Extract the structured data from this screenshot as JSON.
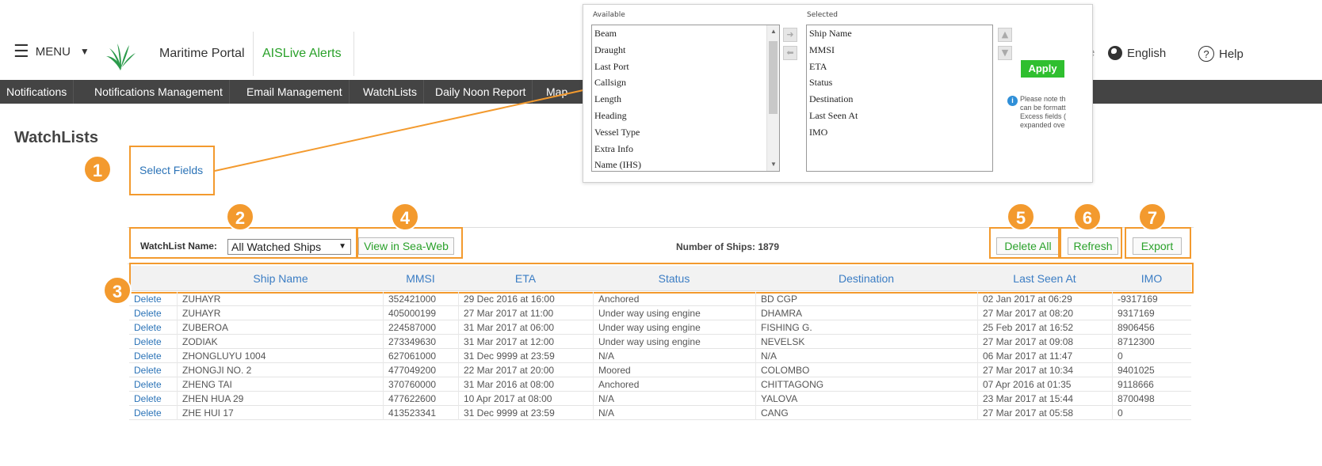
{
  "header": {
    "menu_label": "MENU",
    "portal_title": "Maritime Portal",
    "portal_sub": "AISLive Alerts",
    "faded_text": "e",
    "language": "English",
    "help": "Help",
    "help_symbol": "?"
  },
  "nav": {
    "items": [
      "Notifications",
      "Notifications Management",
      "Email Management",
      "WatchLists",
      "Daily Noon Report",
      "Map"
    ]
  },
  "page": {
    "title": "WatchLists",
    "select_fields": "Select Fields"
  },
  "popup": {
    "available_label": "Available",
    "selected_label": "Selected",
    "available": [
      "Beam",
      "Draught",
      "Last Port",
      "Callsign",
      "Length",
      "Heading",
      "Vessel Type",
      "Extra Info",
      "Name (IHS)"
    ],
    "selected": [
      "Ship Name",
      "MMSI",
      "ETA",
      "Status",
      "Destination",
      "Last Seen At",
      "IMO"
    ],
    "apply": "Apply",
    "note_lines": [
      "Please note th",
      "can be formatt",
      "Excess fields (",
      "expanded ove"
    ]
  },
  "toolbar": {
    "watchlist_label": "WatchList Name:",
    "watchlist_value": "All Watched Ships",
    "view_in_seaweb": "View in Sea-Web",
    "ships_count": "Number of Ships: 1879",
    "delete_all": "Delete All",
    "refresh": "Refresh",
    "export": "Export"
  },
  "table": {
    "columns": [
      "Ship Name",
      "MMSI",
      "ETA",
      "Status",
      "Destination",
      "Last Seen At",
      "IMO"
    ],
    "delete_label": "Delete",
    "rows": [
      [
        "ZUHAYR",
        "352421000",
        "29 Dec 2016 at 16:00",
        "Anchored",
        "BD CGP",
        "02 Jan 2017 at 06:29",
        "-9317169"
      ],
      [
        "ZUHAYR",
        "405000199",
        "27 Mar 2017 at 11:00",
        "Under way using engine",
        "DHAMRA",
        "27 Mar 2017 at 08:20",
        "9317169"
      ],
      [
        "ZUBEROA",
        "224587000",
        "31 Mar 2017 at 06:00",
        "Under way using engine",
        "FISHING G.",
        "25 Feb 2017 at 16:52",
        "8906456"
      ],
      [
        "ZODIAK",
        "273349630",
        "31 Mar 2017 at 12:00",
        "Under way using engine",
        "NEVELSK",
        "27 Mar 2017 at 09:08",
        "8712300"
      ],
      [
        "ZHONGLUYU 1004",
        "627061000",
        "31 Dec 9999 at 23:59",
        "N/A",
        "N/A",
        "06 Mar 2017 at 11:47",
        "0"
      ],
      [
        "ZHONGJI NO. 2",
        "477049200",
        "22 Mar 2017 at 20:00",
        "Moored",
        "COLOMBO",
        "27 Mar 2017 at 10:34",
        "9401025"
      ],
      [
        "ZHENG TAI",
        "370760000",
        "31 Mar 2016 at 08:00",
        "Anchored",
        "CHITTAGONG",
        "07 Apr 2016 at 01:35",
        "9118666"
      ],
      [
        "ZHEN HUA 29",
        "477622600",
        "10 Apr 2017 at 08:00",
        "N/A",
        "YALOVA",
        "23 Mar 2017 at 15:44",
        "8700498"
      ],
      [
        "ZHE HUI 17",
        "413523341",
        "31 Dec 9999 at 23:59",
        "N/A",
        "CANG",
        "27 Mar 2017 at 05:58",
        "0"
      ]
    ]
  },
  "annotations": [
    "1",
    "2",
    "3",
    "4",
    "5",
    "6",
    "7"
  ],
  "colors": {
    "accent_orange": "#f39a2e",
    "nav_bg": "#444444",
    "link_blue": "#2b73b7",
    "green": "#2aa12a"
  }
}
